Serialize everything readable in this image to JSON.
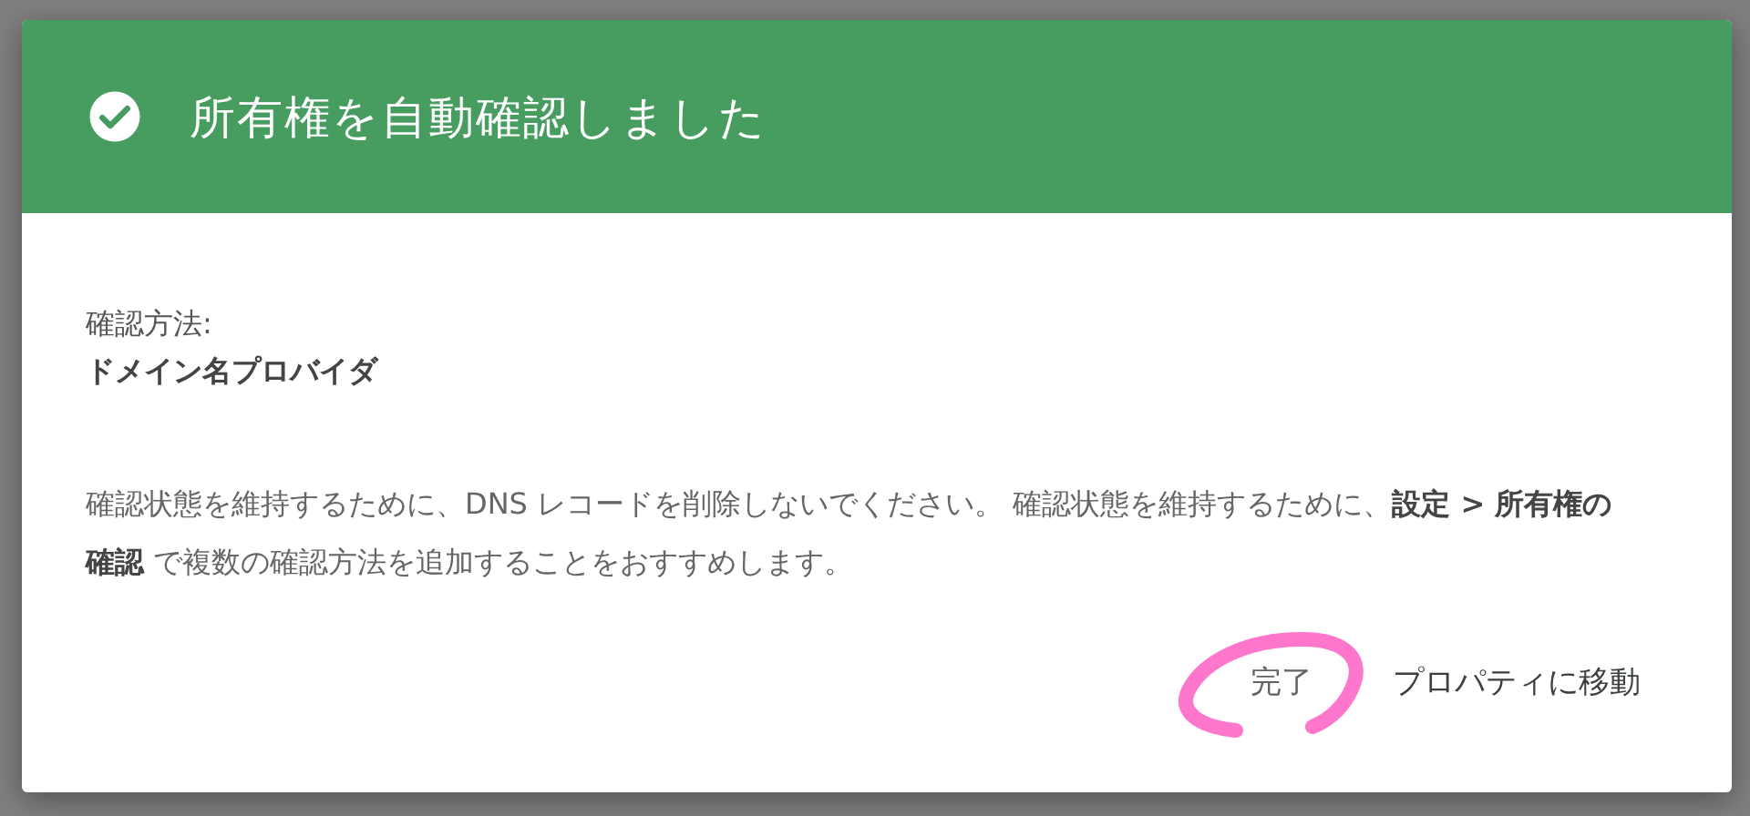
{
  "dialog": {
    "title": "所有権を自動確認しました",
    "method_label": "確認方法:",
    "method_value": "ドメイン名プロバイダ",
    "message": "確認状態を維持するために、DNS レコードを削除しないでください。 確認状態を維持するために、**設定 > 所有権の確認** で複数の確認方法を追加することをおすすめします。",
    "buttons": [
      {
        "label": "完了",
        "circled": true
      },
      {
        "label": "プロパティに移動",
        "circled": false
      }
    ]
  }
}
